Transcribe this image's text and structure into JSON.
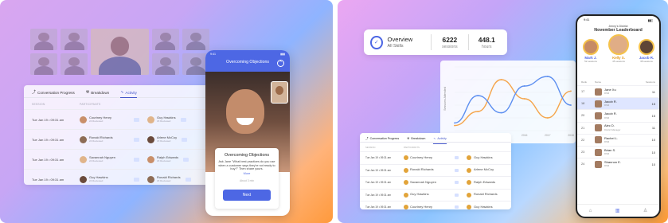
{
  "left": {
    "table": {
      "tabs": [
        {
          "label": "Conversation Progress",
          "icon": "trend-icon"
        },
        {
          "label": "Breakdown",
          "icon": "wrench-icon"
        },
        {
          "label": "Activity",
          "icon": "pulse-icon"
        }
      ],
      "headers": [
        "SESSION",
        "PARTICIPANTS"
      ],
      "rows": [
        {
          "date": "Tue Jan 19 • 09:31 am",
          "p1": "Courtney Henry",
          "p1_sub": "24 Reviewed",
          "p2": "Guy Hawkins",
          "p2_sub": "18 Reviewed"
        },
        {
          "date": "Tue Jan 19 • 09:31 am",
          "p1": "Ronald Richards",
          "p1_sub": "24 Reviewed",
          "p2": "Arlene McCoy",
          "p2_sub": "18 Reviewed"
        },
        {
          "date": "Tue Jan 19 • 09:31 am",
          "p1": "Savannah Nguyen",
          "p1_sub": "24 Reviewed",
          "p2": "Ralph Edwards",
          "p2_sub": "18 Reviewed"
        },
        {
          "date": "Tue Jan 19 • 09:31 am",
          "p1": "Guy Hawkins",
          "p1_sub": "24 Reviewed",
          "p2": "Ronald Richards",
          "p2_sub": "18 Reviewed"
        }
      ]
    },
    "phone": {
      "time": "9:41",
      "title": "Overcoming Objections",
      "card_title": "Overcoming Objections",
      "card_body": "Ask Jane \"What best practices do you use when a customer says they're not ready to buy?\" Then share yours.",
      "card_more": "More",
      "card_step": "About 3 min",
      "next_label": "Next"
    }
  },
  "right": {
    "overview": {
      "title": "Overview",
      "subtitle": "All Skills",
      "sessions_value": "6222",
      "sessions_unit": "sessions",
      "hours_value": "448.1",
      "hours_unit": "hours"
    },
    "chart_data": {
      "type": "line",
      "ylabel": "Sessions Attended",
      "x": [
        "2013",
        "2014",
        "2015",
        "2016",
        "2017",
        "2018"
      ],
      "series": [
        {
          "values": [
            8,
            30,
            80,
            50,
            20,
            62
          ],
          "color": "#f5a54b"
        },
        {
          "values": [
            12,
            55,
            28,
            70,
            85,
            40
          ],
          "color": "#5d8ff0"
        }
      ],
      "ylim": [
        0,
        100
      ],
      "grid": true
    },
    "table": {
      "tabs": [
        {
          "label": "Conversation Progress",
          "icon": "trend-icon"
        },
        {
          "label": "Breakdown",
          "icon": "wrench-icon"
        },
        {
          "label": "Activity",
          "icon": "pulse-icon"
        }
      ],
      "headers": [
        "SESSION",
        "PARTICIPANTS"
      ],
      "rows": [
        {
          "date": "Tue Jan 19 • 09:31 am",
          "p1": "Courtney Henry",
          "p2": "Guy Hawkins"
        },
        {
          "date": "Tue Jan 19 • 09:31 am",
          "p1": "Ronald Richards",
          "p2": "Arlene McCoy"
        },
        {
          "date": "Tue Jan 19 • 09:31 am",
          "p1": "Savannah Nguyen",
          "p2": "Ralph Edwards"
        },
        {
          "date": "Tue Jan 19 • 09:31 am",
          "p1": "Guy Hawkins",
          "p2": "Ronald Richards"
        },
        {
          "date": "Tue Jan 19 • 09:31 am",
          "p1": "Courtney Henry",
          "p2": "Guy Hawkins"
        }
      ]
    },
    "leaderboard": {
      "time": "9:41",
      "district": "Jenny's District",
      "title": "November Leaderboard",
      "podium": [
        {
          "name": "Mark J.",
          "sessions": "52 sessions"
        },
        {
          "name": "Kelly S.",
          "sessions": "45 sessions"
        },
        {
          "name": "Jacob R.",
          "sessions": "38 sessions"
        }
      ],
      "headers": {
        "rank": "Rank",
        "name": "Name",
        "sessions": "Sessions"
      },
      "rows": [
        {
          "rank": "17",
          "name": "Jane Xu",
          "role": "RSM",
          "sessions": "11"
        },
        {
          "rank": "18",
          "name": "Jacob R.",
          "role": "RSM",
          "sessions": "15"
        },
        {
          "rank": "20",
          "name": "Jacob R.",
          "role": "RSM",
          "sessions": "15"
        },
        {
          "rank": "21",
          "name": "Alec D.",
          "role": "District Manager",
          "sessions": "11"
        },
        {
          "rank": "22",
          "name": "Rachel L.",
          "role": "RSM",
          "sessions": "10"
        },
        {
          "rank": "23",
          "name": "Brian S.",
          "role": "RSM",
          "sessions": "10"
        },
        {
          "rank": "24",
          "name": "Shannon E.",
          "role": "RSM",
          "sessions": "10"
        }
      ]
    }
  }
}
